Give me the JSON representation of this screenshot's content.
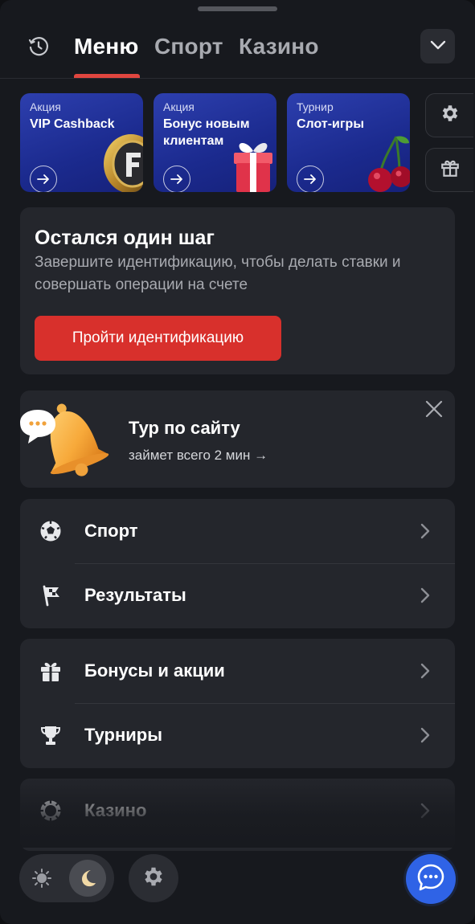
{
  "header": {
    "tabs": [
      {
        "label": "Меню",
        "active": true
      },
      {
        "label": "Спорт",
        "active": false
      },
      {
        "label": "Казино",
        "active": false
      }
    ],
    "icons": {
      "history": "history-clock-icon",
      "dropdown": "chevron-down-icon"
    }
  },
  "promos": [
    {
      "kicker": "Акция",
      "title": "VIP Cashback",
      "art": "gold-coin"
    },
    {
      "kicker": "Акция",
      "title": "Бонус новым клиентам",
      "art": "gift-box"
    },
    {
      "kicker": "Турнир",
      "title": "Слот-игры",
      "art": "cherries"
    }
  ],
  "side_buttons": [
    {
      "icon": "gear-icon"
    },
    {
      "icon": "gift-icon"
    }
  ],
  "identification": {
    "title": "Остался один шаг",
    "text": "Завершите идентификацию, чтобы делать ставки и совершать операции на счете",
    "button_label": "Пройти идентификацию"
  },
  "tour": {
    "title": "Тур по сайту",
    "subtitle": "займет всего 2 мин →"
  },
  "menu_groups": [
    {
      "items": [
        {
          "label": "Спорт",
          "icon": "soccer-ball-icon"
        },
        {
          "label": "Результаты",
          "icon": "flag-icon"
        }
      ]
    },
    {
      "items": [
        {
          "label": "Бонусы и акции",
          "icon": "gift-icon"
        },
        {
          "label": "Турниры",
          "icon": "trophy-icon"
        }
      ]
    },
    {
      "items": [
        {
          "label": "Казино",
          "icon": "casino-chip-icon"
        }
      ]
    }
  ],
  "colors": {
    "accent_red": "#d8302c",
    "tab_underline": "#e0463f",
    "promo_blue": "#1b2a8e",
    "chat_blue": "#2f63e6",
    "card_bg": "#24262c"
  }
}
